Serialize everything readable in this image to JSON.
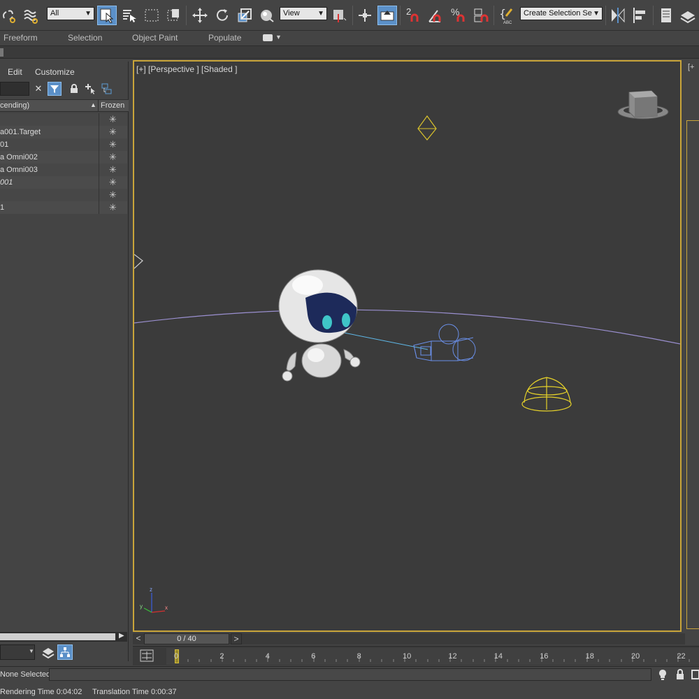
{
  "toolbar": {
    "selection_filter": "All",
    "ref_coord_system": "View",
    "named_selection_placeholder": "Create Selection Se",
    "snap_angle_label": "2",
    "percent_snap_label": "%"
  },
  "ribbon": {
    "tabs": [
      "Freeform",
      "Selection",
      "Object Paint",
      "Populate"
    ]
  },
  "explorer": {
    "menu": [
      "Edit",
      "Customize"
    ],
    "column_name": "cending)",
    "column_frozen": "Frozen",
    "rows": [
      {
        "name": "",
        "italic": false
      },
      {
        "name": "a001.Target",
        "italic": false
      },
      {
        "name": "01",
        "italic": false
      },
      {
        "name": "a Omni002",
        "italic": false
      },
      {
        "name": "a Omni003",
        "italic": false
      },
      {
        "name": "001",
        "italic": true
      },
      {
        "name": "",
        "italic": false
      },
      {
        "name": "1",
        "italic": false
      }
    ],
    "frozen_glyph": "✳"
  },
  "viewport": {
    "label": "[+] [Perspective ] [Shaded ]",
    "right_label": "[+"
  },
  "timeline": {
    "frame_display": "0 / 40",
    "prev": "<",
    "next": ">",
    "ticks": [
      "0",
      "2",
      "4",
      "6",
      "8",
      "10",
      "12",
      "14",
      "16",
      "18",
      "20",
      "22"
    ]
  },
  "status": {
    "selection": "None Selected",
    "rendering_time": "Rendering Time  0:04:02",
    "translation_time": "Translation Time  0:00:37"
  },
  "colors": {
    "viewport_bg": "#3b3b3b",
    "active_border": "#c9a53a",
    "ui_bg": "#444444",
    "camera_wire": "#6a8fe8",
    "light_wire": "#e6d22a",
    "highlight_blue": "#5b90c8"
  }
}
